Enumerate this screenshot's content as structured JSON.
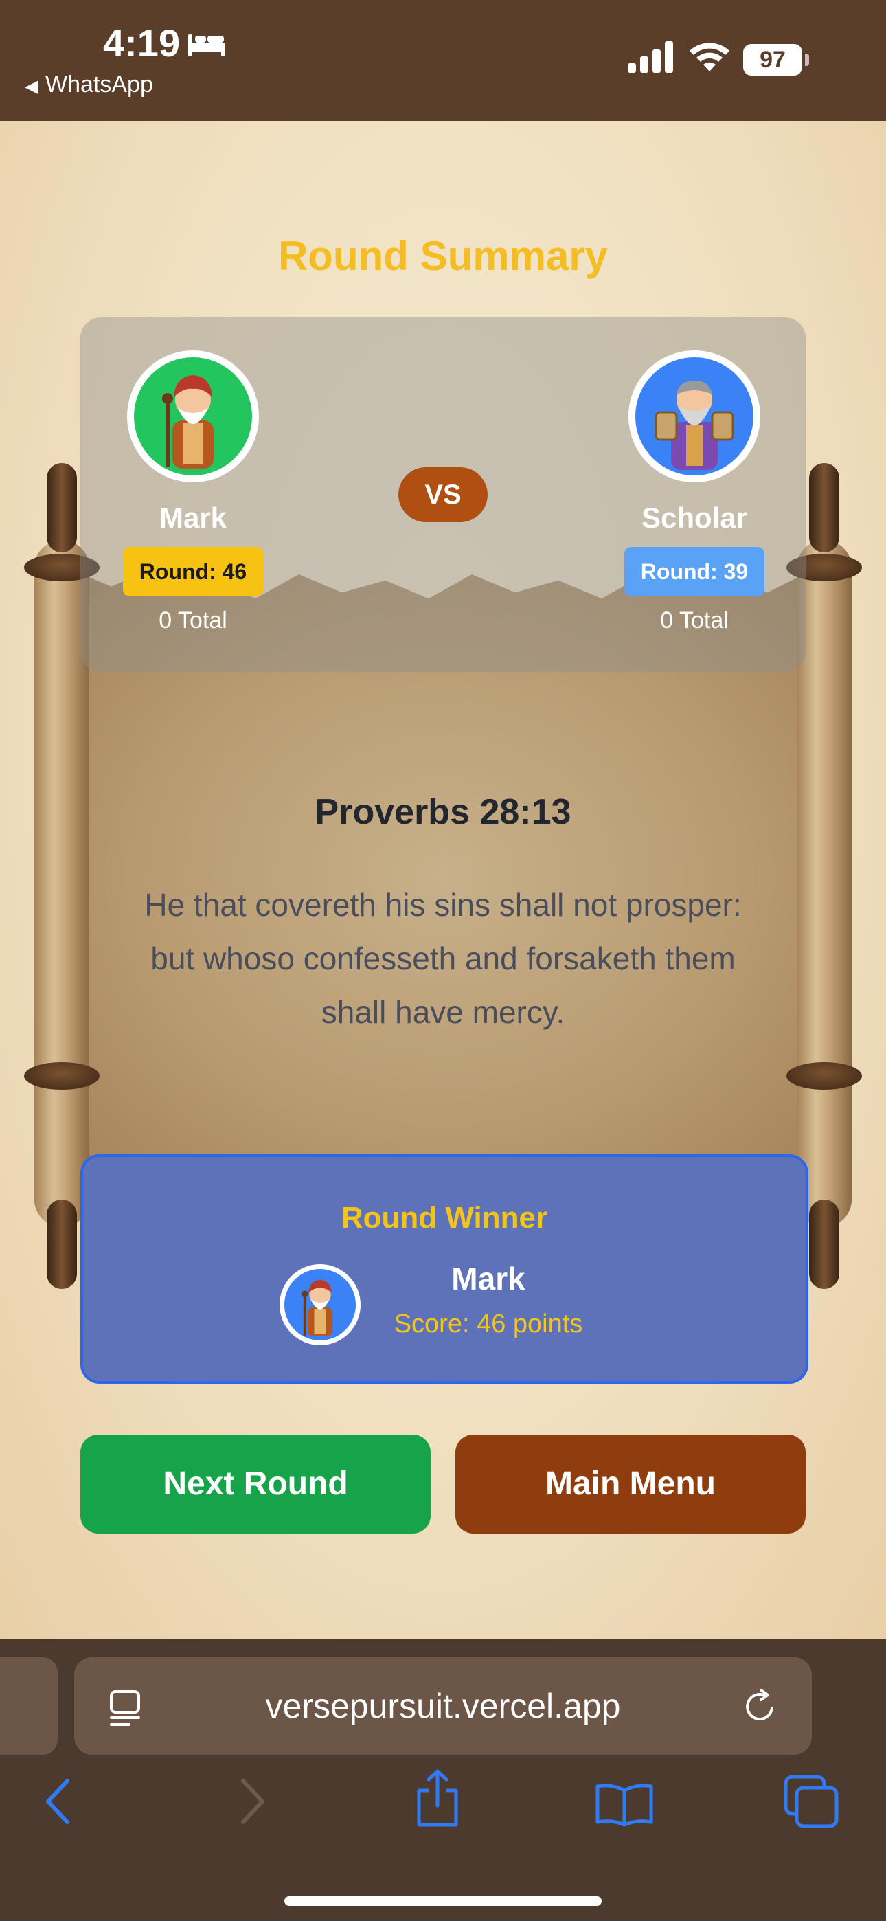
{
  "status_bar": {
    "time": "4:19",
    "back_app": "WhatsApp",
    "battery": "97",
    "icons": [
      "bed-icon",
      "signal-icon",
      "wifi-icon",
      "battery-icon"
    ]
  },
  "page": {
    "title": "Round Summary",
    "players": [
      {
        "name": "Mark",
        "round_label": "Round: 46",
        "total_label": "0 Total",
        "avatar": "elder-with-staff-avatar",
        "ring_color": "#22c55e"
      },
      {
        "name": "Scholar",
        "round_label": "Round: 39",
        "total_label": "0 Total",
        "avatar": "scholar-with-tablets-avatar",
        "ring_color": "#3b82f6"
      }
    ],
    "vs_label": "VS",
    "verse": {
      "reference": "Proverbs 28:13",
      "text": "He that covereth his sins shall not prosper: but whoso confesseth and forsaketh them shall have mercy."
    },
    "winner": {
      "title": "Round Winner",
      "name": "Mark",
      "score": "Score: 46 points"
    },
    "buttons": {
      "next": "Next Round",
      "menu": "Main Menu"
    },
    "colors": {
      "title": "#f3bd23",
      "next_button": "#17a34a",
      "menu_button": "#8f3c0f",
      "winner_card": "#5e72b9",
      "vs_badge": "#b04f12"
    }
  },
  "browser": {
    "url": "versepursuit.vercel.app",
    "toolbar_icons": [
      "back-icon",
      "forward-icon",
      "share-icon",
      "bookmarks-icon",
      "tabs-icon"
    ]
  }
}
